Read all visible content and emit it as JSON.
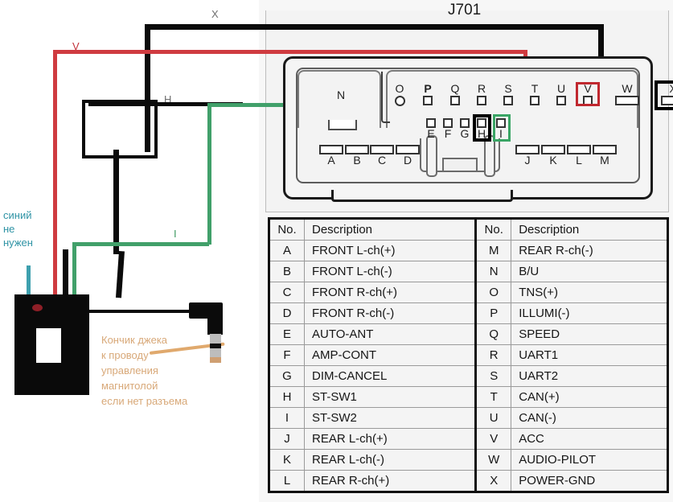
{
  "diagram": {
    "title": "J701",
    "wire_labels": [
      {
        "name": "x-wire-label",
        "text": "X",
        "color": "#6f6f6f"
      },
      {
        "name": "v-wire-label",
        "text": "V",
        "color": "#c2313a"
      },
      {
        "name": "h-wire-label",
        "text": "H",
        "color": "#6f6f6f"
      },
      {
        "name": "i-wire-label",
        "text": "I",
        "color": "#3f9a62"
      }
    ],
    "highlight_colors": {
      "acc_red": "#c0282f",
      "ground_black": "#000000",
      "stsw_green": "#3aa565"
    },
    "wire_colors": {
      "black": "#0b0b0b",
      "red": "#cf3b40",
      "green": "#41a06a",
      "blue": "#3ea0ae",
      "orange": "#e0a96d"
    }
  },
  "annotations": {
    "blue_note": [
      "синий",
      "не",
      "нужен"
    ],
    "jack_note": [
      "Кончик джека",
      "к проводу",
      "управления",
      "магнитолой",
      "если нет разъема"
    ]
  },
  "connector": {
    "row_top": [
      {
        "label": "N",
        "shape": "tab"
      },
      {
        "label": "O",
        "shape": "circle"
      },
      {
        "label": "P",
        "shape": "square"
      },
      {
        "label": "Q",
        "shape": "square"
      },
      {
        "label": "R",
        "shape": "square"
      },
      {
        "label": "S",
        "shape": "square"
      },
      {
        "label": "T",
        "shape": "square"
      },
      {
        "label": "U",
        "shape": "square"
      },
      {
        "label": "V",
        "shape": "square",
        "highlight": "red"
      },
      {
        "label": "W",
        "shape": "wide"
      },
      {
        "label": "X",
        "shape": "wide",
        "highlight": "black"
      }
    ],
    "row_mid": [
      {
        "label": "E",
        "shape": "square"
      },
      {
        "label": "F",
        "shape": "square"
      },
      {
        "label": "G",
        "shape": "square"
      },
      {
        "label": "H",
        "shape": "square",
        "highlight": "black"
      },
      {
        "label": "I",
        "shape": "square",
        "highlight": "green"
      }
    ],
    "row_bottom": [
      {
        "label": "A",
        "shape": "wide"
      },
      {
        "label": "B",
        "shape": "wide"
      },
      {
        "label": "C",
        "shape": "wide"
      },
      {
        "label": "D",
        "shape": "wide"
      },
      {
        "label": "J",
        "shape": "wide"
      },
      {
        "label": "K",
        "shape": "wide"
      },
      {
        "label": "L",
        "shape": "wide"
      },
      {
        "label": "M",
        "shape": "wide"
      }
    ]
  },
  "pinout_table": {
    "headers": {
      "no": "No.",
      "description": "Description"
    },
    "left": [
      {
        "no": "A",
        "description": "FRONT L-ch(+)"
      },
      {
        "no": "B",
        "description": "FRONT L-ch(-)"
      },
      {
        "no": "C",
        "description": "FRONT R-ch(+)"
      },
      {
        "no": "D",
        "description": "FRONT R-ch(-)"
      },
      {
        "no": "E",
        "description": "AUTO-ANT"
      },
      {
        "no": "F",
        "description": "AMP-CONT"
      },
      {
        "no": "G",
        "description": "DIM-CANCEL"
      },
      {
        "no": "H",
        "description": "ST-SW1"
      },
      {
        "no": "I",
        "description": "ST-SW2"
      },
      {
        "no": "J",
        "description": "REAR L-ch(+)"
      },
      {
        "no": "K",
        "description": "REAR L-ch(-)"
      },
      {
        "no": "L",
        "description": "REAR R-ch(+)"
      }
    ],
    "right": [
      {
        "no": "M",
        "description": "REAR R-ch(-)"
      },
      {
        "no": "N",
        "description": "B/U"
      },
      {
        "no": "O",
        "description": "TNS(+)"
      },
      {
        "no": "P",
        "description": "ILLUMI(-)"
      },
      {
        "no": "Q",
        "description": "SPEED"
      },
      {
        "no": "R",
        "description": "UART1"
      },
      {
        "no": "S",
        "description": "UART2"
      },
      {
        "no": "T",
        "description": "CAN(+)"
      },
      {
        "no": "U",
        "description": "CAN(-)"
      },
      {
        "no": "V",
        "description": "ACC"
      },
      {
        "no": "W",
        "description": "AUDIO-PILOT"
      },
      {
        "no": "X",
        "description": "POWER-GND"
      }
    ]
  }
}
